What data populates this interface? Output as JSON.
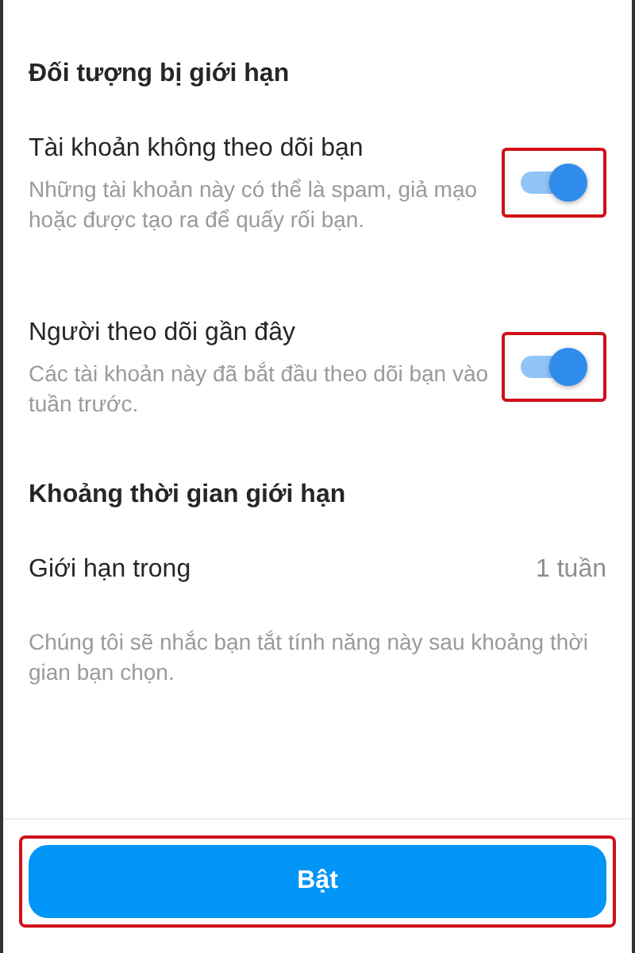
{
  "sections": [
    {
      "heading": "Đối tượng bị giới hạn",
      "items": [
        {
          "kind": "toggle",
          "title": "Tài khoản không theo dõi bạn",
          "description": "Những tài khoản này có thể là spam, giả mạo hoặc được tạo ra để quấy rối bạn.",
          "on": true,
          "highlighted": true
        },
        {
          "kind": "toggle",
          "title": "Người theo dõi gần đây",
          "description": "Các tài khoản này đã bắt đầu theo dõi bạn vào tuần trước.",
          "on": true,
          "highlighted": true
        }
      ]
    },
    {
      "heading": "Khoảng thời gian giới hạn",
      "items": [
        {
          "kind": "value",
          "title": "Giới hạn trong",
          "value": "1 tuần"
        },
        {
          "kind": "note",
          "text": "Chúng tôi sẽ nhắc bạn tắt tính năng này sau khoảng thời gian bạn chọn."
        }
      ]
    }
  ],
  "button": {
    "label": "Bật",
    "highlighted": true
  }
}
